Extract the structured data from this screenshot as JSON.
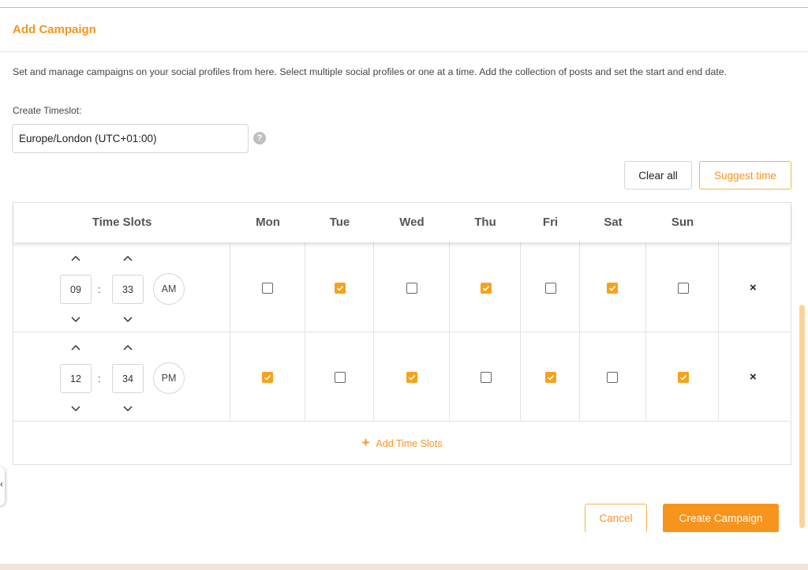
{
  "header": {
    "title": "Add Campaign"
  },
  "description": "Set and manage campaigns on your social profiles from here. Select multiple social profiles or one at a time. Add the collection of posts and set the start and end date.",
  "timeslot": {
    "label": "Create Timeslot:",
    "timezone_value": "Europe/London (UTC+01:00)",
    "help_icon": "?"
  },
  "actions": {
    "clear_all": "Clear all",
    "suggest_time": "Suggest time"
  },
  "table": {
    "headers": [
      "Time Slots",
      "Mon",
      "Tue",
      "Wed",
      "Thu",
      "Fri",
      "Sat",
      "Sun"
    ],
    "rows": [
      {
        "hour": "09",
        "minute": "33",
        "separator": ":",
        "period": "AM",
        "days": [
          false,
          true,
          false,
          true,
          false,
          true,
          false
        ],
        "remove": "×"
      },
      {
        "hour": "12",
        "minute": "34",
        "separator": ":",
        "period": "PM",
        "days": [
          true,
          false,
          true,
          false,
          true,
          false,
          true
        ],
        "remove": "×"
      }
    ],
    "add_label": "Add Time Slots",
    "add_plus": "+"
  },
  "footer": {
    "cancel": "Cancel",
    "create": "Create Campaign"
  },
  "side_chevron": "‹",
  "colors": {
    "accent": "#f7941d",
    "checkbox_on": "#f7a21b"
  }
}
